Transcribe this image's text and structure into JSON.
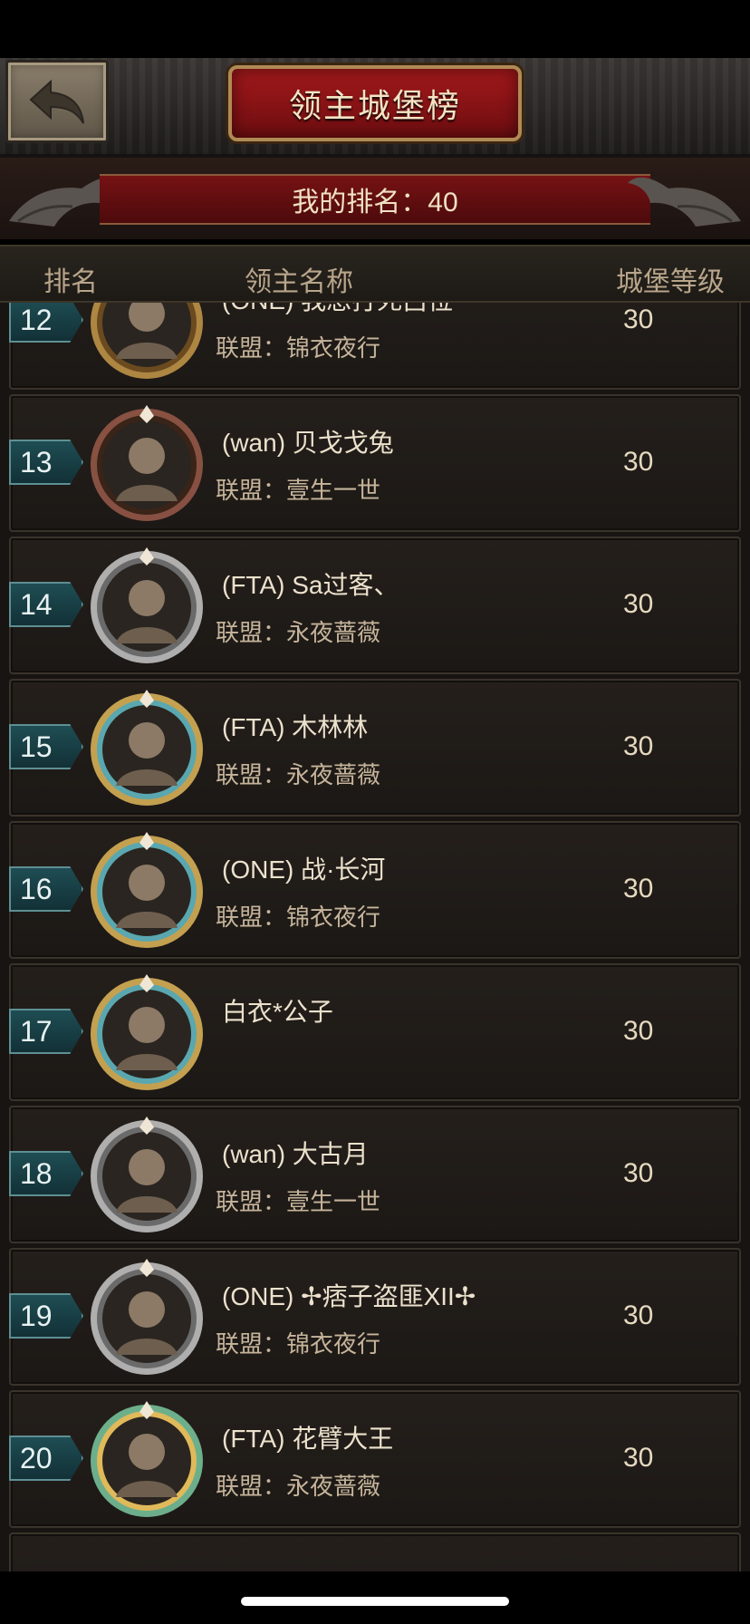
{
  "header": {
    "title": "领主城堡榜",
    "my_rank_label": "我的排名：40"
  },
  "columns": {
    "rank": "排名",
    "lord_name": "领主名称",
    "castle_level": "城堡等级"
  },
  "rows": [
    {
      "rank": "12",
      "name": "(ONE) 我想打死吕位",
      "alliance": "联盟：锦衣夜行",
      "level": "30"
    },
    {
      "rank": "13",
      "name": "(wan) 贝戈戈兔",
      "alliance": "联盟：壹生一世",
      "level": "30"
    },
    {
      "rank": "14",
      "name": "(FTA) Sa过客、",
      "alliance": "联盟：永夜蔷薇",
      "level": "30"
    },
    {
      "rank": "15",
      "name": "(FTA) 木林林",
      "alliance": "联盟：永夜蔷薇",
      "level": "30"
    },
    {
      "rank": "16",
      "name": "(ONE) 战·长河",
      "alliance": "联盟：锦衣夜行",
      "level": "30"
    },
    {
      "rank": "17",
      "name": "白衣*公子",
      "alliance": "",
      "level": "30"
    },
    {
      "rank": "18",
      "name": "(wan) 大古月",
      "alliance": "联盟：壹生一世",
      "level": "30"
    },
    {
      "rank": "19",
      "name": "(ONE) ✢痞子盗匪XII✢",
      "alliance": "联盟：锦衣夜行",
      "level": "30"
    },
    {
      "rank": "20",
      "name": "(FTA) 花臂大王",
      "alliance": "联盟：永夜蔷薇",
      "level": "30"
    }
  ],
  "colors": {
    "title_red": "#a3191b",
    "rank_tag_teal": "#1e4d53",
    "row_bg": "#241f1b"
  },
  "icons": {
    "back": "back-arrow-icon"
  }
}
